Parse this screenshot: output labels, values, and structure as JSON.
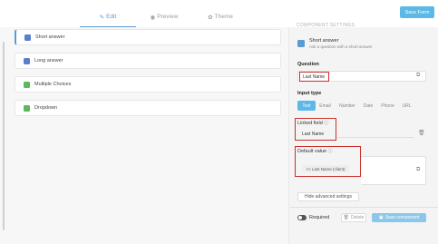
{
  "header": {
    "tabs": [
      {
        "label": "Edit",
        "icon": "pencil-icon"
      },
      {
        "label": "Preview",
        "icon": "eye-icon"
      },
      {
        "label": "Theme",
        "icon": "palette-icon"
      }
    ],
    "save_form_label": "Save Form"
  },
  "components": [
    {
      "label": "Short answer",
      "icon": "short-answer-icon",
      "color": "#5b7fd0"
    },
    {
      "label": "Long answer",
      "icon": "long-answer-icon",
      "color": "#5b7fd0"
    },
    {
      "label": "Multiple Choices",
      "icon": "checkbox-icon",
      "color": "#5cb85c"
    },
    {
      "label": "Dropdown",
      "icon": "dropdown-icon",
      "color": "#5cb85c"
    }
  ],
  "panel": {
    "header_cut": "COMPONENT SETTINGS",
    "component_title": "Short answer",
    "component_desc": "Ask a question with a short answer",
    "question_label": "Question",
    "question_value": "Last Name",
    "input_type_label": "Input type",
    "input_types": [
      "Text",
      "Email",
      "Number",
      "Date",
      "Phone",
      "URL"
    ],
    "linked_field_label": "Linked field",
    "linked_field_value": "Last Name",
    "default_value_label": "Default value",
    "default_value_tag": "<< Last Name (client)",
    "hide_advanced_label": "Hide advanced settings",
    "required_label": "Required",
    "delete_label": "Delete",
    "save_component_label": "Save component"
  },
  "colors": {
    "accent": "#5cb8e6",
    "highlight": "#c9302c"
  }
}
